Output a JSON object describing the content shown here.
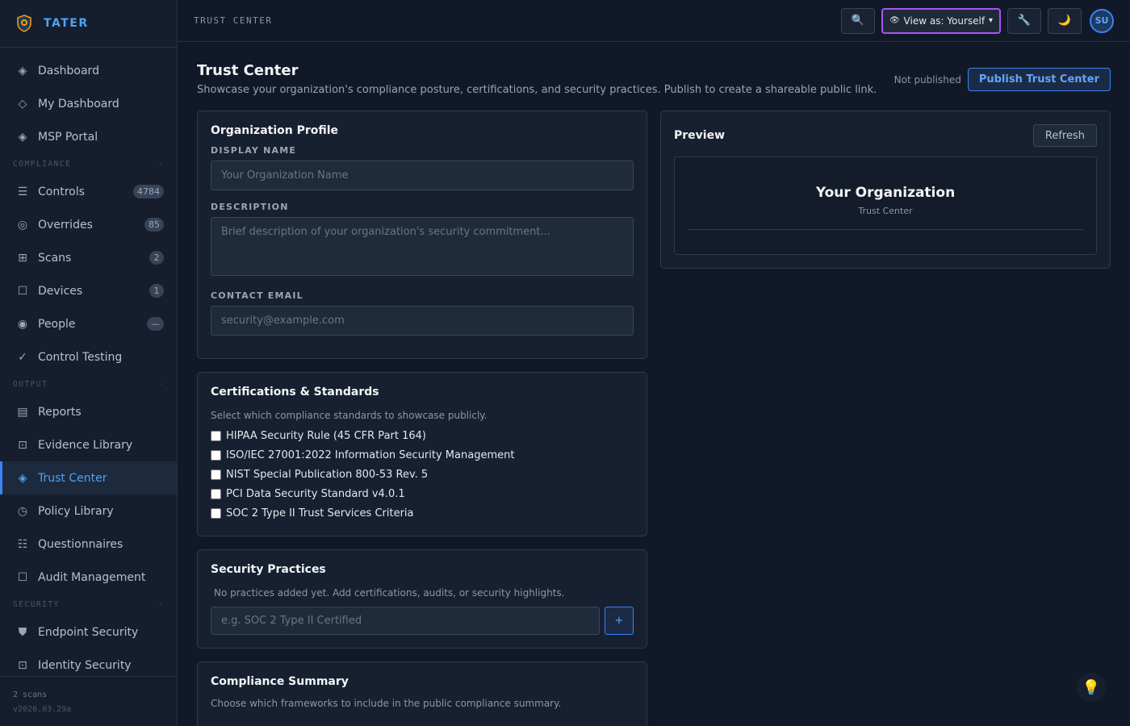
{
  "brand": {
    "name": "TATER",
    "logo_icon": "shield-logo-icon"
  },
  "sidebar": {
    "top_items": [
      {
        "label": "Dashboard",
        "icon": "diamond-icon",
        "glyph": "◈"
      },
      {
        "label": "My Dashboard",
        "icon": "diamond-outline-icon",
        "glyph": "◇"
      },
      {
        "label": "MSP Portal",
        "icon": "diamond-icon",
        "glyph": "◈"
      }
    ],
    "sections": [
      {
        "title": "COMPLIANCE",
        "toggle": "-",
        "items": [
          {
            "label": "Controls",
            "icon": "list-icon",
            "glyph": "☰",
            "badge": "4784"
          },
          {
            "label": "Overrides",
            "icon": "target-icon",
            "glyph": "◎",
            "badge": "85"
          },
          {
            "label": "Scans",
            "icon": "grid-icon",
            "glyph": "⊞",
            "badge": "2"
          },
          {
            "label": "Devices",
            "icon": "device-icon",
            "glyph": "☐",
            "badge": "1"
          },
          {
            "label": "People",
            "icon": "person-icon",
            "glyph": "◉",
            "badge": "—"
          },
          {
            "label": "Control Testing",
            "icon": "check-icon",
            "glyph": "✓",
            "badge": ""
          }
        ]
      },
      {
        "title": "OUTPUT",
        "toggle": "-",
        "items": [
          {
            "label": "Reports",
            "icon": "report-icon",
            "glyph": "▤",
            "badge": ""
          },
          {
            "label": "Evidence Library",
            "icon": "evidence-icon",
            "glyph": "⊡",
            "badge": ""
          },
          {
            "label": "Trust Center",
            "icon": "diamond-icon",
            "glyph": "◈",
            "badge": "",
            "active": true
          },
          {
            "label": "Policy Library",
            "icon": "clock-icon",
            "glyph": "◷",
            "badge": ""
          },
          {
            "label": "Questionnaires",
            "icon": "checklist-icon",
            "glyph": "☷",
            "badge": ""
          },
          {
            "label": "Audit Management",
            "icon": "square-icon",
            "glyph": "☐",
            "badge": ""
          }
        ]
      },
      {
        "title": "SECURITY",
        "toggle": "-",
        "items": [
          {
            "label": "Endpoint Security",
            "icon": "shield-icon",
            "glyph": "⛊",
            "badge": ""
          },
          {
            "label": "Identity Security",
            "icon": "id-icon",
            "glyph": "⊡",
            "badge": ""
          }
        ]
      }
    ],
    "footer": {
      "scans": "2 scans",
      "version": "v2026.03.29a"
    }
  },
  "topbar": {
    "breadcrumb": "TRUST CENTER",
    "search_icon": "🔍",
    "view_as": "View as: Yourself",
    "tools_icon": "🔧",
    "theme_icon": "🌙",
    "avatar": "SU"
  },
  "page": {
    "title": "Trust Center",
    "description": "Showcase your organization's compliance posture, certifications, and security practices. Publish to create a shareable public link.",
    "publish_status": "Not published",
    "publish_button": "Publish Trust Center"
  },
  "org_profile": {
    "title": "Organization Profile",
    "display_name_label": "DISPLAY NAME",
    "display_name_placeholder": "Your Organization Name",
    "description_label": "DESCRIPTION",
    "description_placeholder": "Brief description of your organization's security commitment...",
    "email_label": "CONTACT EMAIL",
    "email_placeholder": "security@example.com"
  },
  "certifications": {
    "title": "Certifications & Standards",
    "hint": "Select which compliance standards to showcase publicly.",
    "items": [
      {
        "label": "HIPAA Security Rule (45 CFR Part 164)",
        "checked": false
      },
      {
        "label": "ISO/IEC 27001:2022 Information Security Management",
        "checked": false
      },
      {
        "label": "NIST Special Publication 800-53 Rev. 5",
        "checked": false
      },
      {
        "label": "PCI Data Security Standard v4.0.1",
        "checked": false
      },
      {
        "label": "SOC 2 Type II Trust Services Criteria",
        "checked": false
      }
    ]
  },
  "practices": {
    "title": "Security Practices",
    "empty": "No practices added yet. Add certifications, audits, or security highlights.",
    "placeholder": "e.g. SOC 2 Type II Certified",
    "add_label": "+"
  },
  "compliance_summary": {
    "title": "Compliance Summary",
    "hint": "Choose which frameworks to include in the public compliance summary."
  },
  "preview": {
    "title": "Preview",
    "refresh": "Refresh",
    "org_name": "Your Organization",
    "subtitle": "Trust Center"
  },
  "tip_icon": "💡"
}
